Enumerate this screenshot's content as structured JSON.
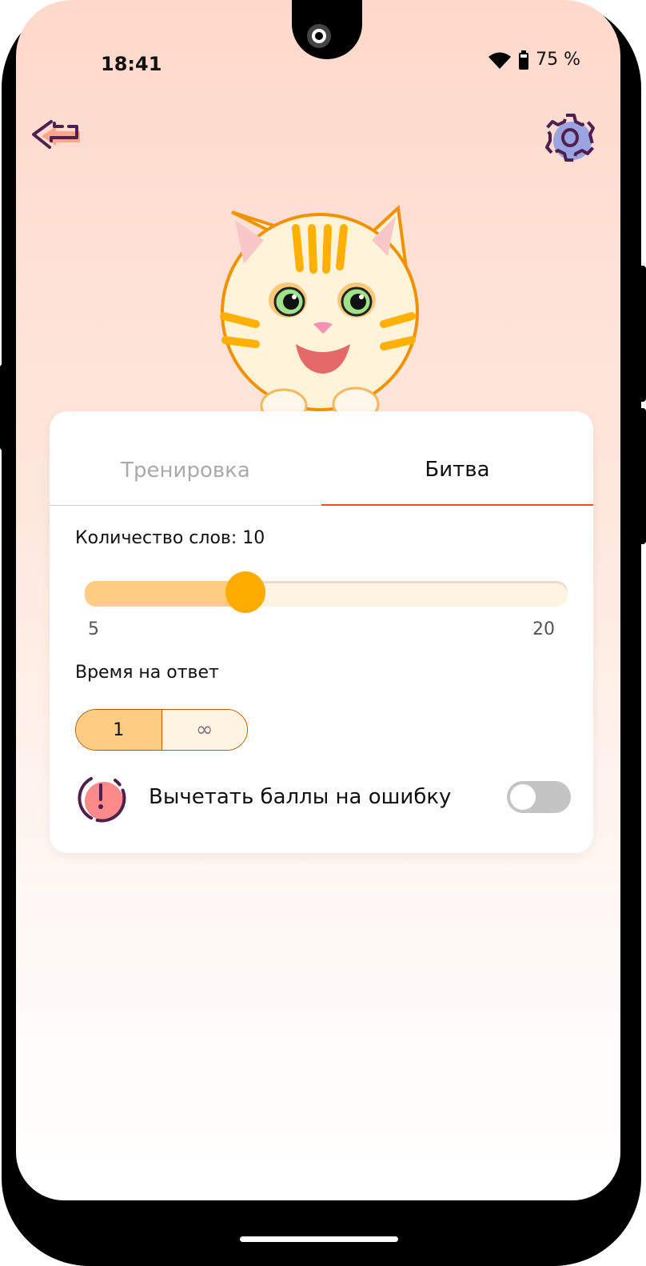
{
  "status_bar": {
    "time": "18:41",
    "battery": "75 %"
  },
  "header": {
    "back_icon": "back-arrow-icon",
    "settings_icon": "gear-icon"
  },
  "tabs": [
    {
      "label": "Тренировка",
      "active": false
    },
    {
      "label": "Битва",
      "active": true
    }
  ],
  "word_count": {
    "label": "Количество слов: 10",
    "value": 10,
    "min": 5,
    "max": 20,
    "min_label": "5",
    "max_label": "20"
  },
  "answer_time": {
    "label": "Время на ответ",
    "options": [
      "1",
      "∞"
    ],
    "selected": "1"
  },
  "penalty": {
    "label": "Вычетать баллы на ошибку",
    "enabled": false
  },
  "colors": {
    "accent": "#ffab00",
    "tab_underline": "#e7522a",
    "fill": "#fecd83"
  }
}
